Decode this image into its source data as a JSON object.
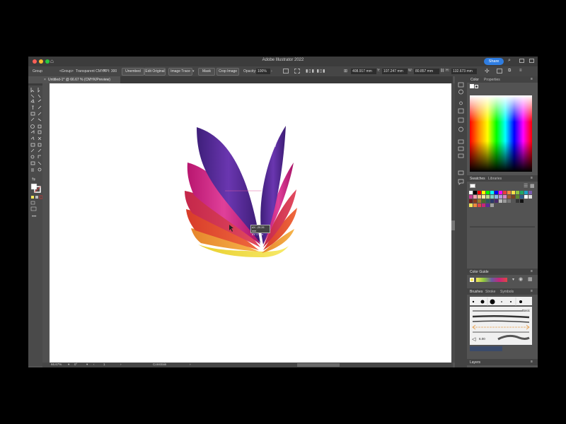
{
  "window": {
    "title": "Adobe Illustrator 2022",
    "share_label": "Share"
  },
  "control_bar": {
    "selection_type": "Group",
    "group_label": "<Group>",
    "transparency_label": "Transparent CMYK",
    "ppi_label": "PPI: 300",
    "embed_button": "Unembed",
    "edit_original_button": "Edit Original",
    "image_trace_button": "Image Trace",
    "mask_button": "Mask",
    "crop_image_button": "Crop Image",
    "opacity_label": "Opacity:",
    "opacity_value": "100%",
    "x_value": "408.917 mm",
    "y_value": "107.247 mm",
    "w_value": "80.857 mm",
    "h_value": "132.673 mm"
  },
  "document_tab": {
    "label": "Untitled-1* @ 66.67 % (CMYK/Preview)"
  },
  "canvas": {
    "tooltip_dx": "dX: -20.26 mm",
    "tooltip_dy": "dY: 0 mm"
  },
  "status_bar": {
    "zoom": "66.67%",
    "rotation": "0°",
    "artboard": "1",
    "mode": "Constrain"
  },
  "panels": {
    "color_tab": "Color",
    "properties_tab": "Properties",
    "swatches_tab": "Swatches",
    "libraries_tab": "Libraries",
    "color_guide_tab": "Color Guide",
    "brushes_tab": "Brushes",
    "stroke_tab": "Stroke",
    "symbols_tab": "Symbols",
    "basic_brush_label": "Basic",
    "brush_size": "6.00",
    "layers_tab": "Layers"
  },
  "colors": {
    "ui_dark": "#535353",
    "accent_blue": "#2f7de1",
    "artwork": [
      "#f2e347",
      "#f2a93b",
      "#ea5a34",
      "#d93a4e",
      "#c8247a",
      "#5b2a9b"
    ]
  }
}
